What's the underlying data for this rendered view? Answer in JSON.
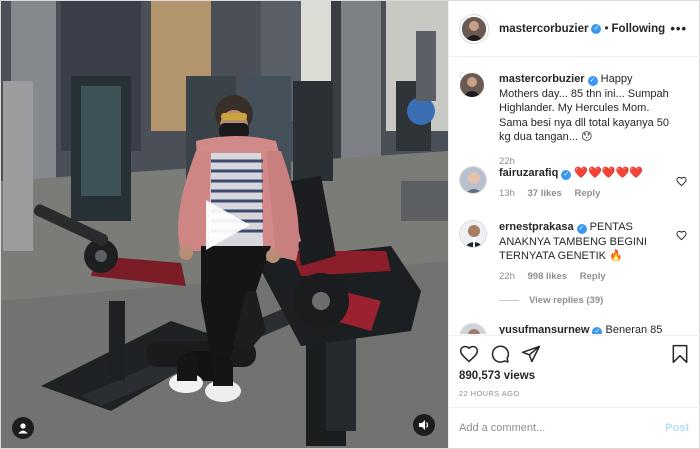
{
  "post": {
    "author": "mastercorbuzier",
    "verified": true,
    "follow_sep": "•",
    "follow_status": "Following",
    "more_label": "•••"
  },
  "caption": {
    "username": "mastercorbuzier",
    "text": "Happy Mothers day... 85 thn ini... Sumpah Highlander. My Hercules Mom. Sama besi nya dll total kayanya 50 kg dua tangan... 😯",
    "time": "22h"
  },
  "comments": [
    {
      "username": "fairuzarafiq",
      "verified": true,
      "text": "❤️❤️❤️❤️❤️",
      "time": "13h",
      "likes": "37 likes",
      "reply_label": "Reply"
    },
    {
      "username": "ernestprakasa",
      "verified": true,
      "text": "PENTAS ANAKNYA TAMBENG BEGINI TERNYATA GENETIK 🔥",
      "time": "22h",
      "likes": "998 likes",
      "reply_label": "Reply",
      "view_replies": "View replies (39)"
    },
    {
      "username": "yusufmansurnew",
      "verified": true,
      "text": "Beneran 85"
    }
  ],
  "actions": {
    "views": "890,573 views",
    "timestamp": "22 HOURS AGO"
  },
  "composer": {
    "placeholder": "Add a comment...",
    "post_label": "Post"
  },
  "colors": {
    "verified": "#3897f0",
    "heart_emoji": "#ed4956",
    "post_disabled": "#b2dffc",
    "muted": "#8e8e8e"
  },
  "icons": [
    "play-icon",
    "profile-icon",
    "volume-icon",
    "heart-icon",
    "comment-icon",
    "share-icon",
    "bookmark-icon",
    "more-icon"
  ]
}
